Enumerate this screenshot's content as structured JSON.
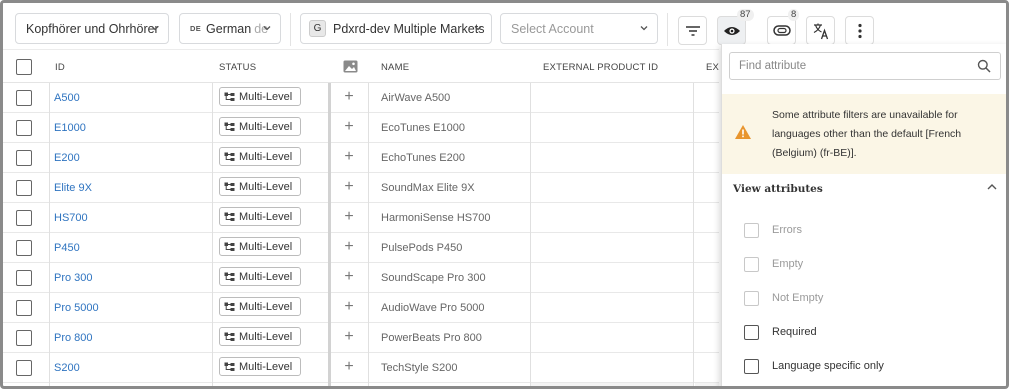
{
  "toolbar": {
    "category": "Kopfhörer und Ohrhörer",
    "language_code": "DE",
    "language": "German",
    "language_suffix": "de",
    "market_badge": "G",
    "market": "Pdxrd-dev Multiple Markets",
    "account_placeholder": "Select Account",
    "icons": [
      "filter-icon",
      "eye-icon",
      "toggle-icon",
      "translate-icon",
      "more-icon"
    ],
    "eye_count": "87",
    "toggle_count": "8"
  },
  "table": {
    "headers": {
      "id": "ID",
      "status": "STATUS",
      "name": "NAME",
      "external_product_id": "EXTERNAL PRODUCT ID",
      "ext_truncated": "EXT"
    },
    "rows": [
      {
        "id": "A500",
        "status": "Multi-Level",
        "name": "AirWave A500"
      },
      {
        "id": "E1000",
        "status": "Multi-Level",
        "name": "EcoTunes E1000"
      },
      {
        "id": "E200",
        "status": "Multi-Level",
        "name": "EchoTunes E200"
      },
      {
        "id": "Elite 9X",
        "status": "Multi-Level",
        "name": "SoundMax Elite 9X"
      },
      {
        "id": "HS700",
        "status": "Multi-Level",
        "name": "HarmoniSense HS700"
      },
      {
        "id": "P450",
        "status": "Multi-Level",
        "name": "PulsePods P450"
      },
      {
        "id": "Pro 300",
        "status": "Multi-Level",
        "name": "SoundScape Pro 300"
      },
      {
        "id": "Pro 5000",
        "status": "Multi-Level",
        "name": "AudioWave Pro 5000"
      },
      {
        "id": "Pro 800",
        "status": "Multi-Level",
        "name": "PowerBeats Pro 800"
      },
      {
        "id": "S200",
        "status": "Multi-Level",
        "name": "TechStyle S200"
      }
    ]
  },
  "panel": {
    "search_placeholder": "Find attribute",
    "warning": "Some attribute filters are unavailable for languages other than the default [French (Belgium) (fr-BE)].",
    "section_title": "View attributes",
    "options": [
      {
        "label": "Errors",
        "enabled": false
      },
      {
        "label": "Empty",
        "enabled": false
      },
      {
        "label": "Not Empty",
        "enabled": false
      },
      {
        "label": "Required",
        "enabled": true
      },
      {
        "label": "Language specific only",
        "enabled": true
      }
    ]
  },
  "colors": {
    "link": "#2f74c0",
    "warning_bg": "#fbf6e6",
    "warning_icon": "#e8952e"
  }
}
